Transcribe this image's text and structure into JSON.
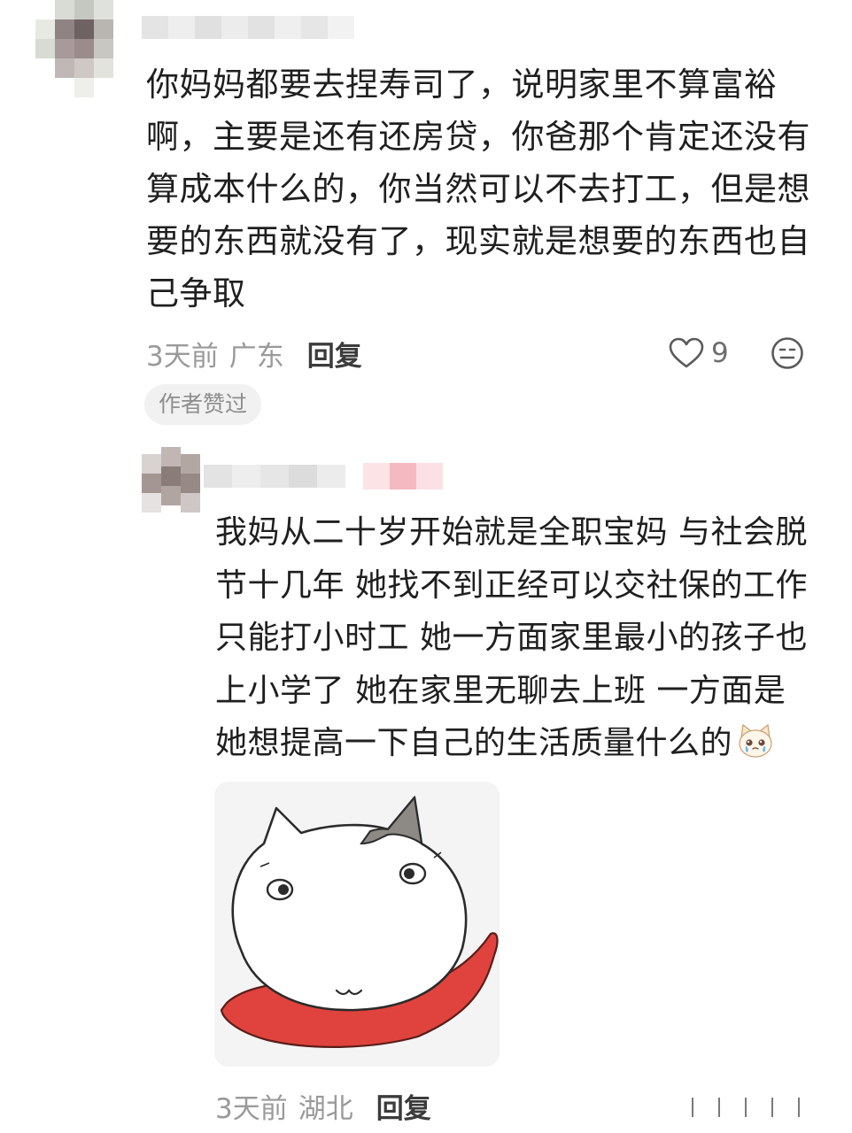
{
  "comments": [
    {
      "text": "你妈妈都要去捏寿司了，说明家里不算富裕\n啊，主要是还有还房贷，你爸那个肯定还没有\n算成本什么的，你当然可以不去打工，但是想\n要的东西就没有了，现实就是想要的东西也自\n己争取",
      "time": "3天前",
      "location": "广东",
      "reply_label": "回复",
      "like_count": "9",
      "badge": "作者赞过"
    }
  ],
  "reply": {
    "lines": [
      "我妈从二十岁开始就是全职宝妈 与社会脱",
      "节十几年 她找不到正经可以交社保的工作",
      "只能打小时工 她一方面家里最小的孩子也",
      "上小学了 她在家里无聊去上班  一方面是",
      "她想提高一下自己的生活质量什么的"
    ],
    "time": "3天前",
    "location": "湖北",
    "reply_label": "回复"
  },
  "icons": {
    "like": "heart-outline-icon",
    "emoji_reaction": "meh-face-icon",
    "inline_emoji": "crying-cat-emoji",
    "sticker": "cat-sticker"
  },
  "colors": {
    "text": "#1f1f1f",
    "meta": "#9a9a9a",
    "badge_bg": "#f1f1f1",
    "sticker_red": "#e0433d"
  }
}
